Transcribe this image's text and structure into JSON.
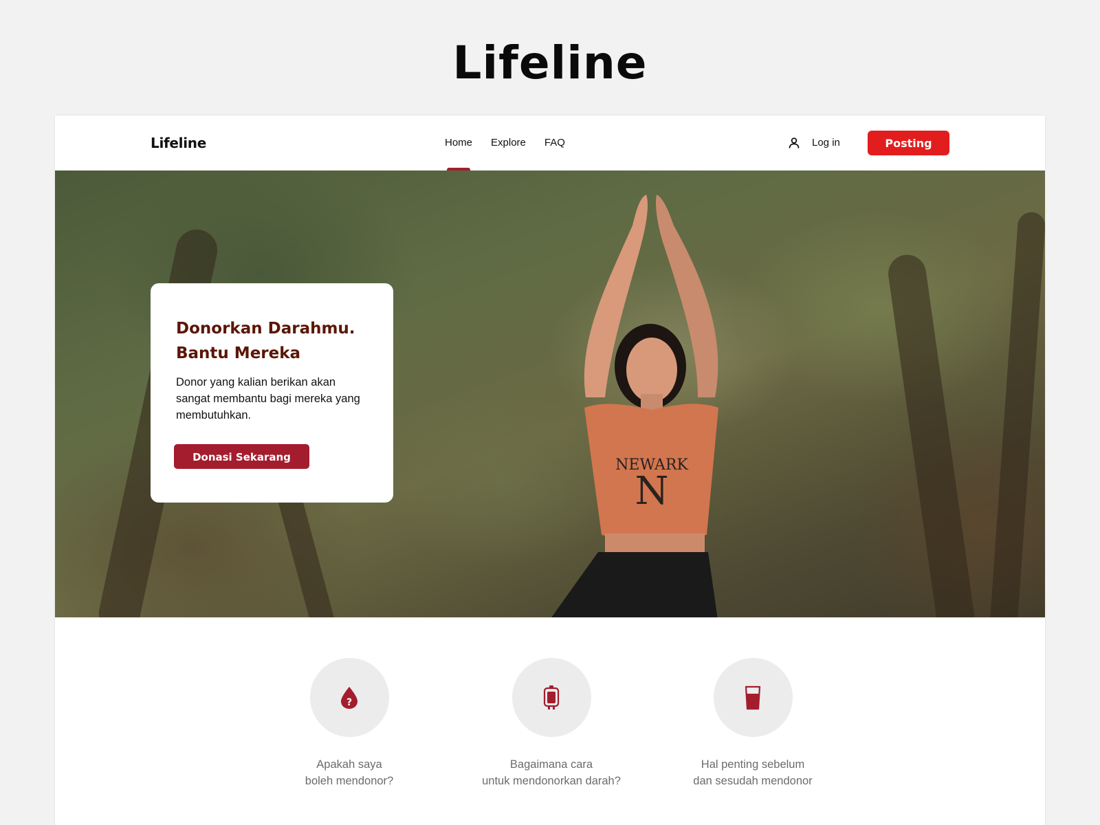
{
  "showcase": {
    "title": "Lifeline"
  },
  "nav": {
    "brand": "Lifeline",
    "links": [
      {
        "label": "Home",
        "active": true
      },
      {
        "label": "Explore",
        "active": false
      },
      {
        "label": "FAQ",
        "active": false
      }
    ],
    "login_label": "Log in",
    "posting_label": "Posting"
  },
  "hero": {
    "title_line1": "Donorkan Darahmu.",
    "title_line2": "Bantu Mereka",
    "description": "Donor yang kalian berikan akan sangat membantu bagi mereka yang membutuhkan.",
    "cta_label": "Donasi Sekarang",
    "shirt_text": "NEWARK",
    "shirt_letter": "N"
  },
  "features": [
    {
      "icon": "blood-drop-question-icon",
      "line1": "Apakah saya",
      "line2": "boleh mendonor?"
    },
    {
      "icon": "blood-bag-icon",
      "line1": "Bagaimana cara",
      "line2": "untuk mendonorkan darah?"
    },
    {
      "icon": "drink-glass-icon",
      "line1": "Hal penting sebelum",
      "line2": "dan sesudah mendonor"
    }
  ],
  "colors": {
    "brand_red": "#e21d1d",
    "accent_maroon": "#a31d2e",
    "title_brown": "#5b1606",
    "icon_circle": "#ececec"
  }
}
